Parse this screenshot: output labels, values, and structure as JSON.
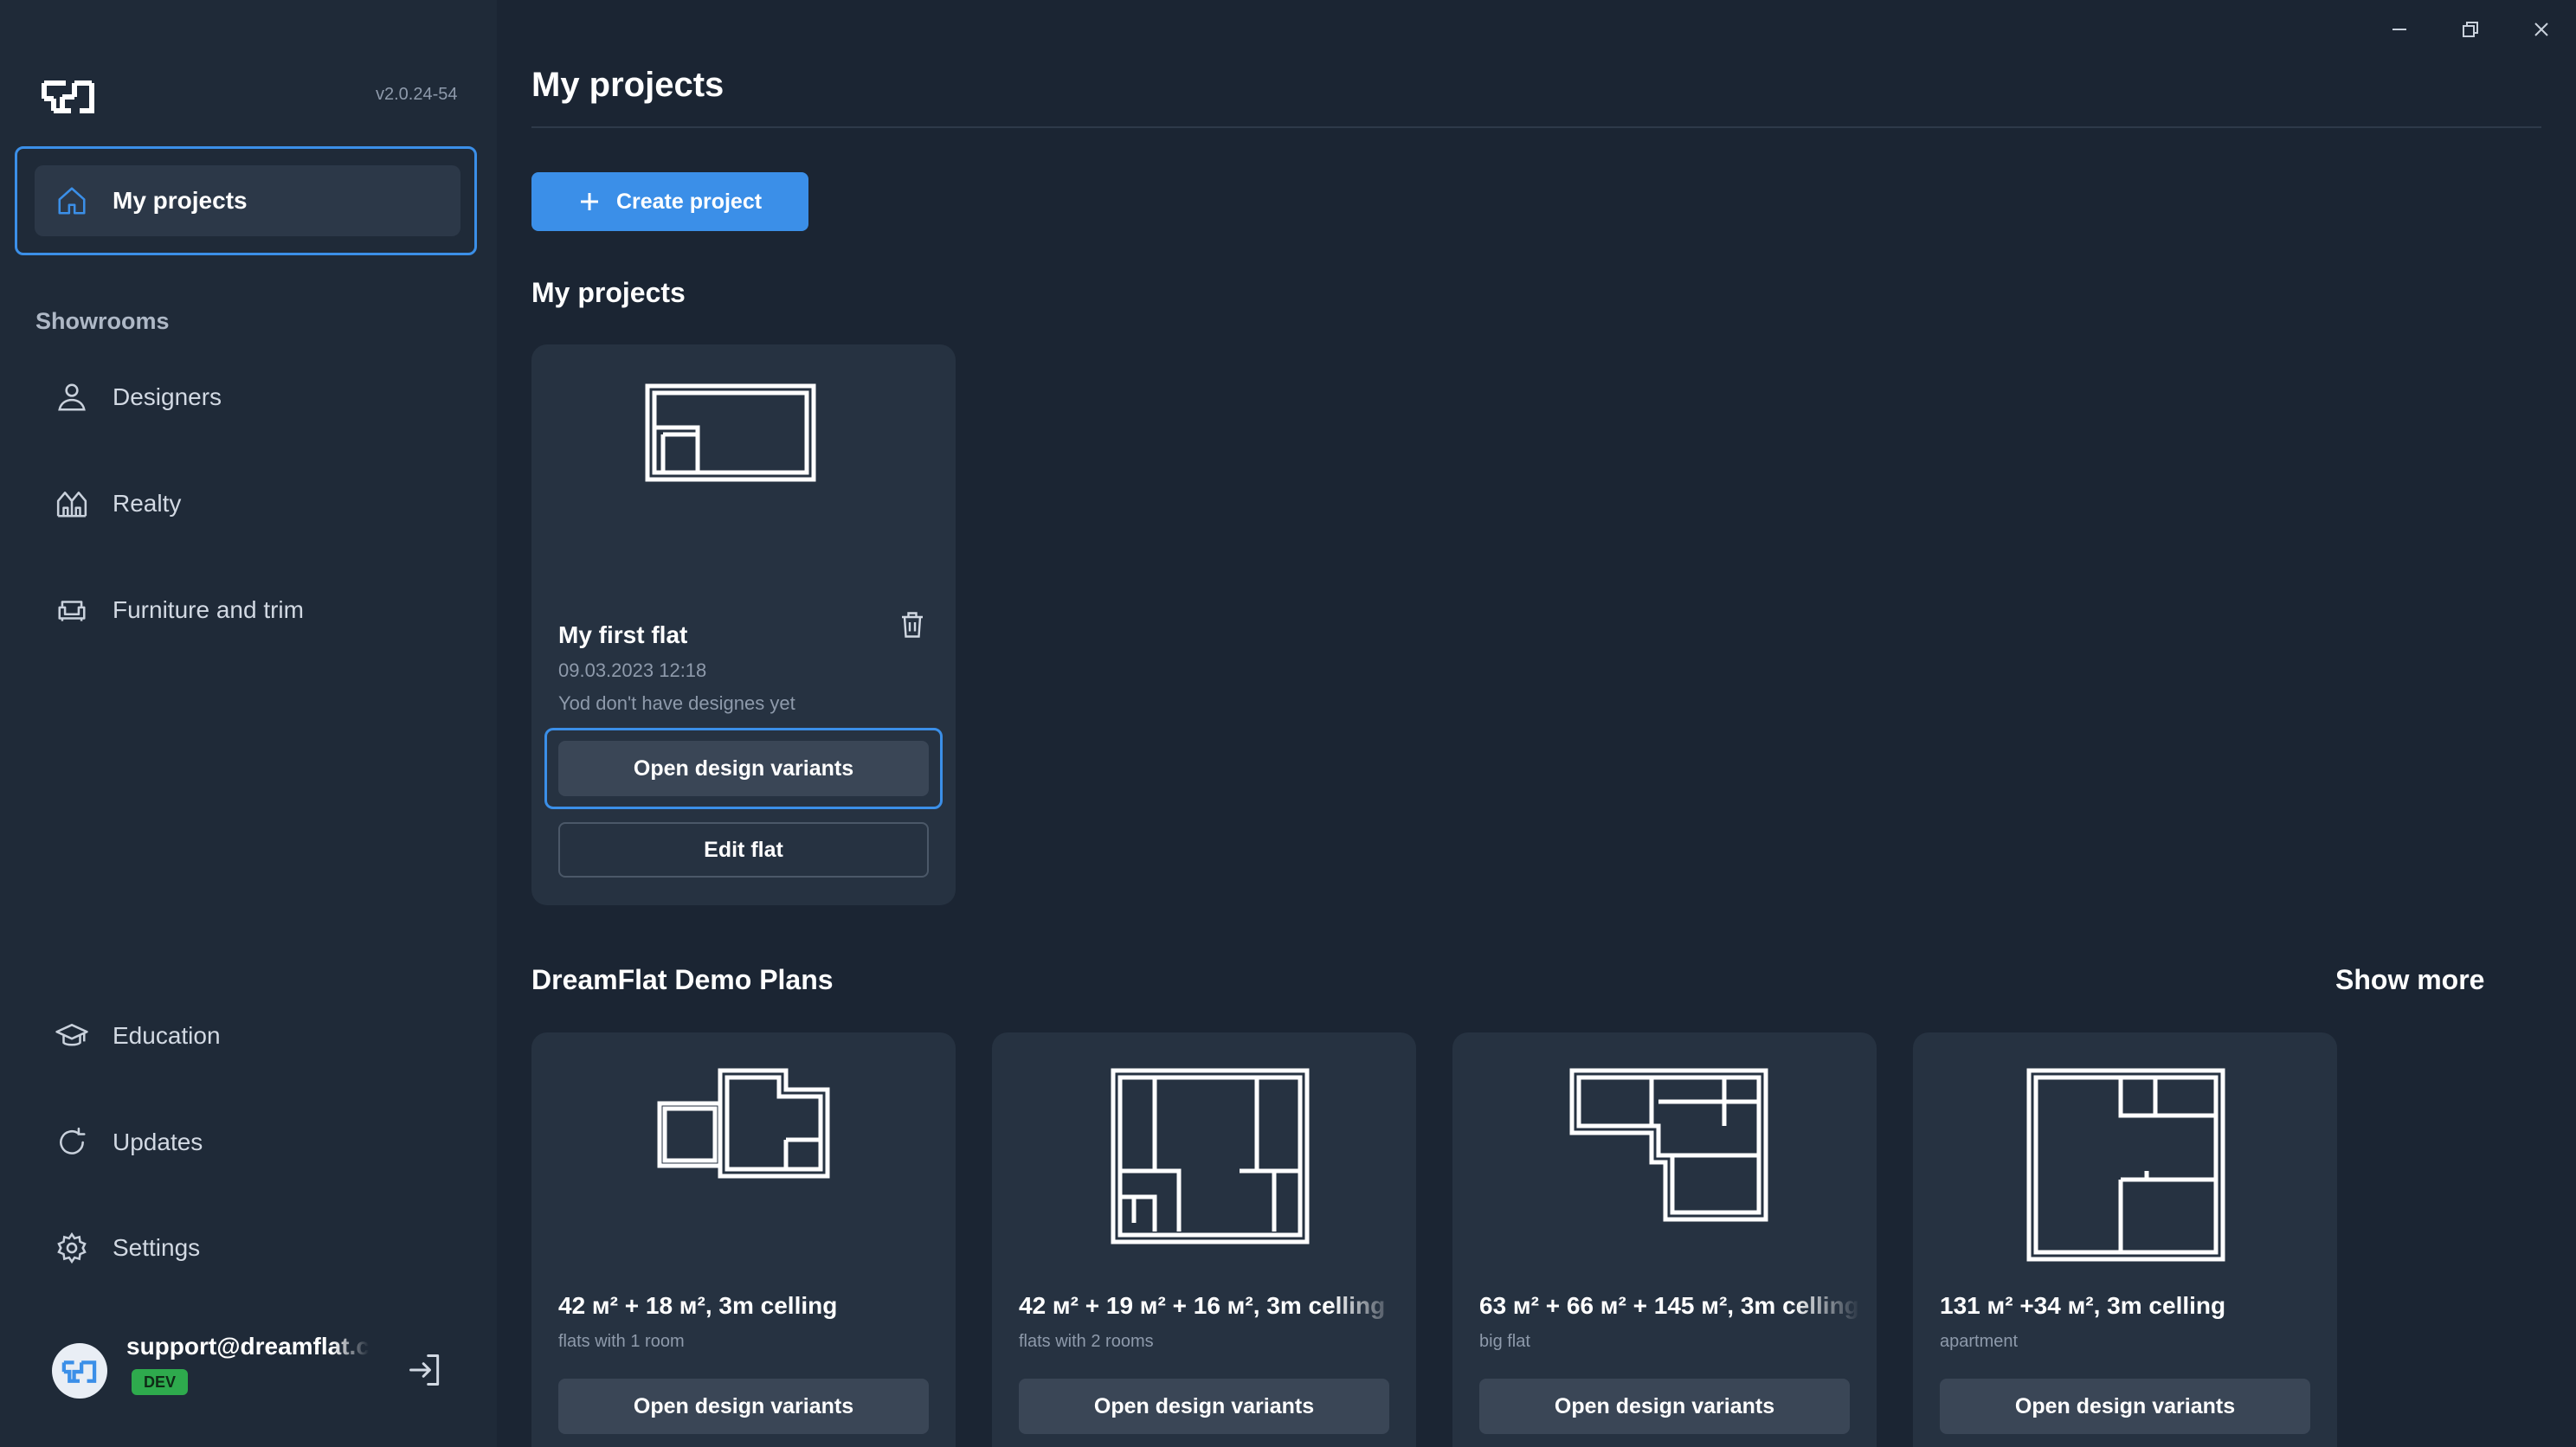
{
  "app": {
    "version": "v2.0.24-54"
  },
  "sidebar": {
    "active_item": {
      "label": "My projects",
      "icon": "home-icon"
    },
    "section_label": "Showrooms",
    "showroom_items": [
      {
        "label": "Designers",
        "icon": "users-icon"
      },
      {
        "label": "Realty",
        "icon": "building-icon"
      },
      {
        "label": "Furniture and trim",
        "icon": "sofa-icon"
      }
    ],
    "bottom_items": [
      {
        "label": "Education",
        "icon": "graduation-cap-icon"
      },
      {
        "label": "Updates",
        "icon": "refresh-icon"
      },
      {
        "label": "Settings",
        "icon": "gear-icon"
      }
    ],
    "user": {
      "email": "support@dreamflat.c",
      "badge": "DEV"
    }
  },
  "main": {
    "title": "My projects",
    "create_button": "Create project",
    "my_projects_heading": "My projects",
    "project": {
      "name": "My first flat",
      "date": "09.03.2023 12:18",
      "status": "Yod don't have designes yet",
      "open_button": "Open design variants",
      "edit_button": "Edit flat"
    },
    "demo_heading": "DreamFlat Demo Plans",
    "show_more": "Show more",
    "demo_plans": [
      {
        "title": "42 м² + 18 м², 3m celling",
        "subtitle": "flats with 1 room",
        "button": "Open design variants"
      },
      {
        "title": "42 м² + 19 м² + 16 м², 3m celling",
        "subtitle": "flats with 2 rooms",
        "button": "Open design variants"
      },
      {
        "title": "63 м² + 66 м² + 145 м², 3m celling",
        "subtitle": "big flat",
        "button": "Open design variants"
      },
      {
        "title": "131 м² +34 м², 3m celling",
        "subtitle": "apartment",
        "button": "Open design variants"
      }
    ]
  },
  "colors": {
    "accent": "#3b8fe8",
    "background": "#1b2533",
    "sidebar": "#1f2a38",
    "card": "#263241",
    "badge": "#2eaa4d"
  }
}
